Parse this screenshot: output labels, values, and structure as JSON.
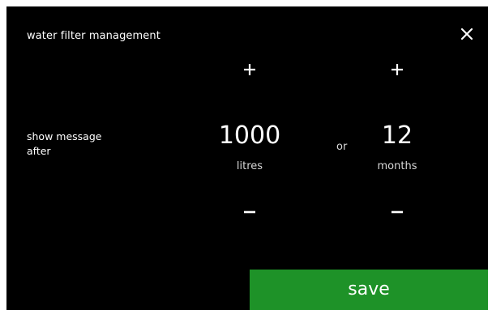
{
  "header": {
    "title": "water filter management",
    "close_icon": "close-icon"
  },
  "setting": {
    "label": "show message after",
    "or_text": "or"
  },
  "litres": {
    "value": "1000",
    "unit": "litres",
    "increase_icon": "plus-icon",
    "decrease_icon": "minus-icon"
  },
  "months": {
    "value": "12",
    "unit": "months",
    "increase_icon": "plus-icon",
    "decrease_icon": "minus-icon"
  },
  "footer": {
    "save_label": "save"
  },
  "colors": {
    "background": "#000000",
    "text": "#ffffff",
    "save_button": "#1e9228"
  }
}
